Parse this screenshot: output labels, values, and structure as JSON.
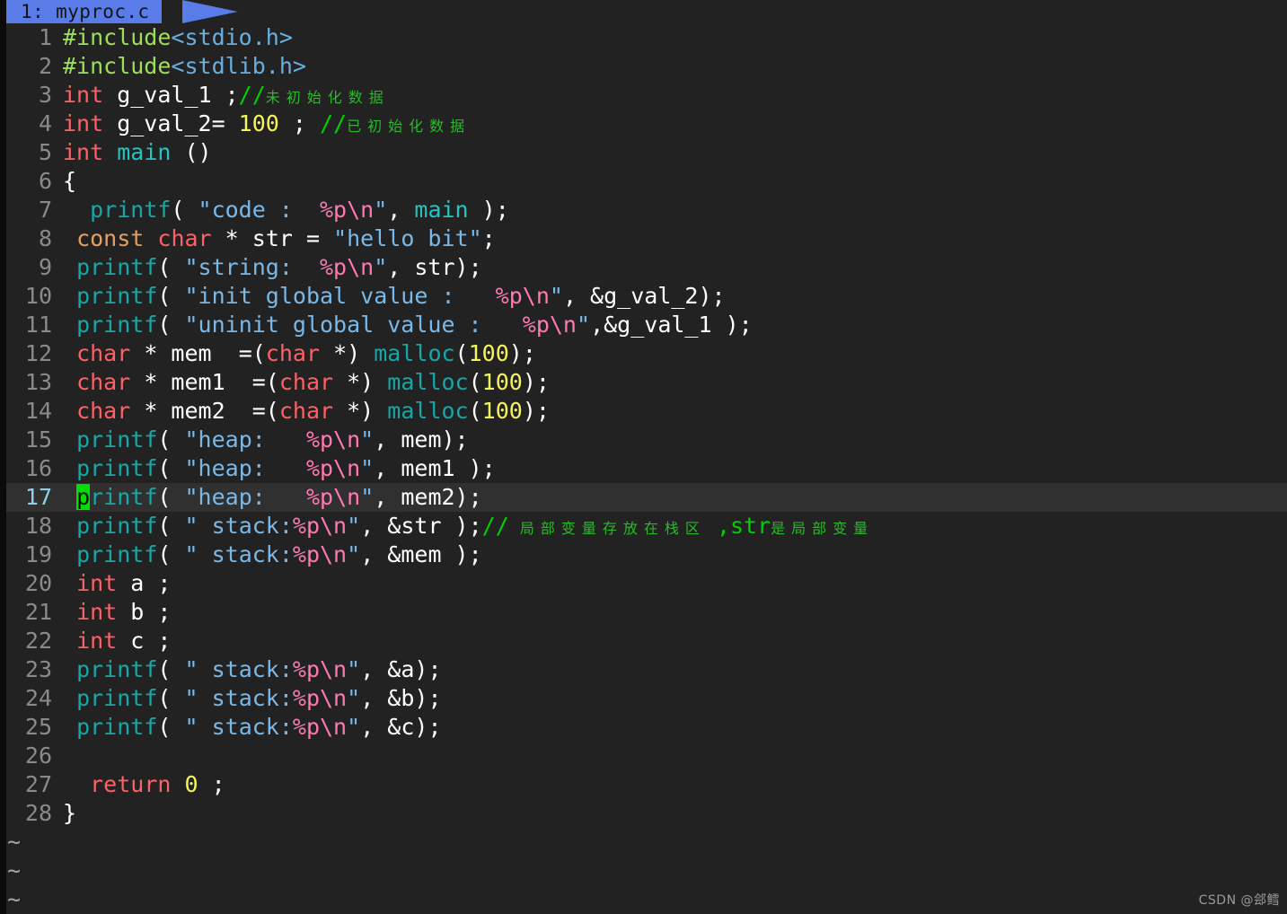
{
  "editor": {
    "name": "vim",
    "background_color": "#222222",
    "cursorline_color": "#303030",
    "cursor_color": "#00e000",
    "linenumber_color": "#8a8a8a"
  },
  "tabline": {
    "active_tab_label": "1: myproc.c",
    "active_tab_background": "#5a7ce8",
    "active_tab_text_color": "#141414"
  },
  "watermark": {
    "text": "CSDN @郐鳕"
  },
  "filler": {
    "marker": "~",
    "count": 3
  },
  "lines": [
    {
      "n": "1",
      "tokens": [
        {
          "t": "#include",
          "c": "pre"
        },
        {
          "t": "<stdio.h>",
          "c": "hdr"
        }
      ]
    },
    {
      "n": "2",
      "tokens": [
        {
          "t": "#include",
          "c": "pre"
        },
        {
          "t": "<stdlib.h>",
          "c": "hdr"
        }
      ]
    },
    {
      "n": "3",
      "tokens": [
        {
          "t": "int",
          "c": "kw"
        },
        {
          "t": " g_val_1 ;",
          "c": "plain"
        },
        {
          "t": "//",
          "c": "cmt"
        },
        {
          "t": "未初始化数据",
          "c": "cmt-cjk"
        }
      ]
    },
    {
      "n": "4",
      "tokens": [
        {
          "t": "int",
          "c": "kw"
        },
        {
          "t": " g_val_2= ",
          "c": "plain"
        },
        {
          "t": "100",
          "c": "num"
        },
        {
          "t": " ; ",
          "c": "plain"
        },
        {
          "t": "//",
          "c": "cmt"
        },
        {
          "t": "已初始化数据",
          "c": "cmt-cjk"
        }
      ]
    },
    {
      "n": "5",
      "tokens": [
        {
          "t": "int",
          "c": "kw"
        },
        {
          "t": " ",
          "c": "plain"
        },
        {
          "t": "main",
          "c": "fn2"
        },
        {
          "t": " ()",
          "c": "plain"
        }
      ]
    },
    {
      "n": "6",
      "tokens": [
        {
          "t": "{",
          "c": "plain"
        }
      ]
    },
    {
      "n": "7",
      "tokens": [
        {
          "t": "  ",
          "c": "plain"
        },
        {
          "t": "printf",
          "c": "fn"
        },
        {
          "t": "( ",
          "c": "plain"
        },
        {
          "t": "\"code :  ",
          "c": "str"
        },
        {
          "t": "%p\\n",
          "c": "spec"
        },
        {
          "t": "\"",
          "c": "str"
        },
        {
          "t": ", ",
          "c": "plain"
        },
        {
          "t": "main",
          "c": "fn2"
        },
        {
          "t": " );",
          "c": "plain"
        }
      ]
    },
    {
      "n": "8",
      "tokens": [
        {
          "t": " ",
          "c": "plain"
        },
        {
          "t": "const",
          "c": "storage"
        },
        {
          "t": " ",
          "c": "plain"
        },
        {
          "t": "char",
          "c": "kw"
        },
        {
          "t": " * str = ",
          "c": "plain"
        },
        {
          "t": "\"hello bit\"",
          "c": "str"
        },
        {
          "t": ";",
          "c": "plain"
        }
      ]
    },
    {
      "n": "9",
      "tokens": [
        {
          "t": " ",
          "c": "plain"
        },
        {
          "t": "printf",
          "c": "fn"
        },
        {
          "t": "( ",
          "c": "plain"
        },
        {
          "t": "\"string:  ",
          "c": "str"
        },
        {
          "t": "%p\\n",
          "c": "spec"
        },
        {
          "t": "\"",
          "c": "str"
        },
        {
          "t": ", str);",
          "c": "plain"
        }
      ]
    },
    {
      "n": "10",
      "tokens": [
        {
          "t": " ",
          "c": "plain"
        },
        {
          "t": "printf",
          "c": "fn"
        },
        {
          "t": "( ",
          "c": "plain"
        },
        {
          "t": "\"init global value :   ",
          "c": "str"
        },
        {
          "t": "%p\\n",
          "c": "spec"
        },
        {
          "t": "\"",
          "c": "str"
        },
        {
          "t": ", &g_val_2);",
          "c": "plain"
        }
      ]
    },
    {
      "n": "11",
      "tokens": [
        {
          "t": " ",
          "c": "plain"
        },
        {
          "t": "printf",
          "c": "fn"
        },
        {
          "t": "( ",
          "c": "plain"
        },
        {
          "t": "\"uninit global value :   ",
          "c": "str"
        },
        {
          "t": "%p\\n",
          "c": "spec"
        },
        {
          "t": "\"",
          "c": "str"
        },
        {
          "t": ",&g_val_1 );",
          "c": "plain"
        }
      ]
    },
    {
      "n": "12",
      "tokens": [
        {
          "t": " ",
          "c": "plain"
        },
        {
          "t": "char",
          "c": "kw"
        },
        {
          "t": " * mem  =(",
          "c": "plain"
        },
        {
          "t": "char",
          "c": "kw"
        },
        {
          "t": " *) ",
          "c": "plain"
        },
        {
          "t": "malloc",
          "c": "fn"
        },
        {
          "t": "(",
          "c": "plain"
        },
        {
          "t": "100",
          "c": "num"
        },
        {
          "t": ");",
          "c": "plain"
        }
      ]
    },
    {
      "n": "13",
      "tokens": [
        {
          "t": " ",
          "c": "plain"
        },
        {
          "t": "char",
          "c": "kw"
        },
        {
          "t": " * mem1  =(",
          "c": "plain"
        },
        {
          "t": "char",
          "c": "kw"
        },
        {
          "t": " *) ",
          "c": "plain"
        },
        {
          "t": "malloc",
          "c": "fn"
        },
        {
          "t": "(",
          "c": "plain"
        },
        {
          "t": "100",
          "c": "num"
        },
        {
          "t": ");",
          "c": "plain"
        }
      ]
    },
    {
      "n": "14",
      "tokens": [
        {
          "t": " ",
          "c": "plain"
        },
        {
          "t": "char",
          "c": "kw"
        },
        {
          "t": " * mem2  =(",
          "c": "plain"
        },
        {
          "t": "char",
          "c": "kw"
        },
        {
          "t": " *) ",
          "c": "plain"
        },
        {
          "t": "malloc",
          "c": "fn"
        },
        {
          "t": "(",
          "c": "plain"
        },
        {
          "t": "100",
          "c": "num"
        },
        {
          "t": ");",
          "c": "plain"
        }
      ]
    },
    {
      "n": "15",
      "tokens": [
        {
          "t": " ",
          "c": "plain"
        },
        {
          "t": "printf",
          "c": "fn"
        },
        {
          "t": "( ",
          "c": "plain"
        },
        {
          "t": "\"heap:   ",
          "c": "str"
        },
        {
          "t": "%p\\n",
          "c": "spec"
        },
        {
          "t": "\"",
          "c": "str"
        },
        {
          "t": ", mem);",
          "c": "plain"
        }
      ]
    },
    {
      "n": "16",
      "tokens": [
        {
          "t": " ",
          "c": "plain"
        },
        {
          "t": "printf",
          "c": "fn"
        },
        {
          "t": "( ",
          "c": "plain"
        },
        {
          "t": "\"heap:   ",
          "c": "str"
        },
        {
          "t": "%p\\n",
          "c": "spec"
        },
        {
          "t": "\"",
          "c": "str"
        },
        {
          "t": ", mem1 );",
          "c": "plain"
        }
      ]
    },
    {
      "n": "17",
      "cursorline": true,
      "tokens": [
        {
          "t": " ",
          "c": "plain"
        },
        {
          "t": "p",
          "c": "cursor"
        },
        {
          "t": "rintf",
          "c": "fn"
        },
        {
          "t": "( ",
          "c": "plain"
        },
        {
          "t": "\"heap:   ",
          "c": "str"
        },
        {
          "t": "%p\\n",
          "c": "spec"
        },
        {
          "t": "\"",
          "c": "str"
        },
        {
          "t": ", mem2);",
          "c": "plain"
        }
      ]
    },
    {
      "n": "18",
      "tokens": [
        {
          "t": " ",
          "c": "plain"
        },
        {
          "t": "printf",
          "c": "fn"
        },
        {
          "t": "( ",
          "c": "plain"
        },
        {
          "t": "\" stack:",
          "c": "str"
        },
        {
          "t": "%p\\n",
          "c": "spec"
        },
        {
          "t": "\"",
          "c": "str"
        },
        {
          "t": ", &str );",
          "c": "plain"
        },
        {
          "t": "//",
          "c": "cmt"
        },
        {
          "t": " 局部变量存放在栈区 ",
          "c": "cmt-cjk"
        },
        {
          "t": ",str",
          "c": "cmt"
        },
        {
          "t": "是局部变量",
          "c": "cmt-cjk"
        }
      ]
    },
    {
      "n": "19",
      "tokens": [
        {
          "t": " ",
          "c": "plain"
        },
        {
          "t": "printf",
          "c": "fn"
        },
        {
          "t": "( ",
          "c": "plain"
        },
        {
          "t": "\" stack:",
          "c": "str"
        },
        {
          "t": "%p\\n",
          "c": "spec"
        },
        {
          "t": "\"",
          "c": "str"
        },
        {
          "t": ", &mem );",
          "c": "plain"
        }
      ]
    },
    {
      "n": "20",
      "tokens": [
        {
          "t": " ",
          "c": "plain"
        },
        {
          "t": "int",
          "c": "kw"
        },
        {
          "t": " a ;",
          "c": "plain"
        }
      ]
    },
    {
      "n": "21",
      "tokens": [
        {
          "t": " ",
          "c": "plain"
        },
        {
          "t": "int",
          "c": "kw"
        },
        {
          "t": " b ;",
          "c": "plain"
        }
      ]
    },
    {
      "n": "22",
      "tokens": [
        {
          "t": " ",
          "c": "plain"
        },
        {
          "t": "int",
          "c": "kw"
        },
        {
          "t": " c ;",
          "c": "plain"
        }
      ]
    },
    {
      "n": "23",
      "tokens": [
        {
          "t": " ",
          "c": "plain"
        },
        {
          "t": "printf",
          "c": "fn"
        },
        {
          "t": "( ",
          "c": "plain"
        },
        {
          "t": "\" stack:",
          "c": "str"
        },
        {
          "t": "%p\\n",
          "c": "spec"
        },
        {
          "t": "\"",
          "c": "str"
        },
        {
          "t": ", &a);",
          "c": "plain"
        }
      ]
    },
    {
      "n": "24",
      "tokens": [
        {
          "t": " ",
          "c": "plain"
        },
        {
          "t": "printf",
          "c": "fn"
        },
        {
          "t": "( ",
          "c": "plain"
        },
        {
          "t": "\" stack:",
          "c": "str"
        },
        {
          "t": "%p\\n",
          "c": "spec"
        },
        {
          "t": "\"",
          "c": "str"
        },
        {
          "t": ", &b);",
          "c": "plain"
        }
      ]
    },
    {
      "n": "25",
      "tokens": [
        {
          "t": " ",
          "c": "plain"
        },
        {
          "t": "printf",
          "c": "fn"
        },
        {
          "t": "( ",
          "c": "plain"
        },
        {
          "t": "\" stack:",
          "c": "str"
        },
        {
          "t": "%p\\n",
          "c": "spec"
        },
        {
          "t": "\"",
          "c": "str"
        },
        {
          "t": ", &c);",
          "c": "plain"
        }
      ]
    },
    {
      "n": "26",
      "tokens": []
    },
    {
      "n": "27",
      "tokens": [
        {
          "t": "  ",
          "c": "plain"
        },
        {
          "t": "return",
          "c": "kw"
        },
        {
          "t": " ",
          "c": "plain"
        },
        {
          "t": "0",
          "c": "num"
        },
        {
          "t": " ;",
          "c": "plain"
        }
      ]
    },
    {
      "n": "28",
      "tokens": [
        {
          "t": "}",
          "c": "plain"
        }
      ]
    }
  ]
}
